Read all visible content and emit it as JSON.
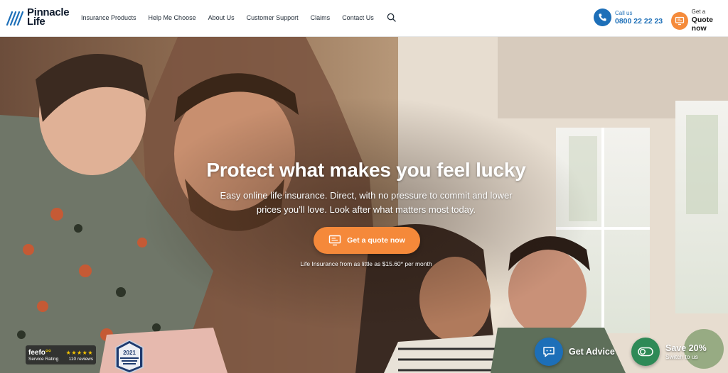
{
  "brand": {
    "line1": "Pinnacle",
    "line2": "Life",
    "logo_icon": "pinnacle-stripes-logo"
  },
  "nav": {
    "items": [
      {
        "label": "Insurance Products"
      },
      {
        "label": "Help Me Choose"
      },
      {
        "label": "About Us"
      },
      {
        "label": "Customer Support"
      },
      {
        "label": "Claims"
      },
      {
        "label": "Contact Us"
      }
    ],
    "search_icon": "search-icon"
  },
  "call": {
    "small": "Call us",
    "number": "0800 22 22 23",
    "icon": "phone-icon"
  },
  "quote": {
    "small": "Get a",
    "big": "Quote now",
    "icon": "monitor-quote-icon"
  },
  "hero": {
    "title": "Protect what makes you feel lucky",
    "subtitle": "Easy online life insurance. Direct, with no pressure to commit and lower prices you’ll love. Look after what matters most today.",
    "cta_label": "Get a quote now",
    "price_note": "Life Insurance from as little as $15.60* per month"
  },
  "feefo": {
    "logo": "feefo",
    "rating_label": "Service Rating",
    "reviews": "110 reviews",
    "stars": "★★★★★"
  },
  "award": {
    "year": "2021"
  },
  "advice": {
    "label": "Get Advice",
    "icon": "chat-advisor-icon"
  },
  "save": {
    "title": "Save 20%",
    "subtitle": "Switch to us",
    "icon": "toggle-switch-icon"
  },
  "colors": {
    "brand_blue": "#1d6fb8",
    "accent_orange": "#f5893a",
    "save_green": "#2e8a57",
    "text_dark": "#1f2a36"
  }
}
